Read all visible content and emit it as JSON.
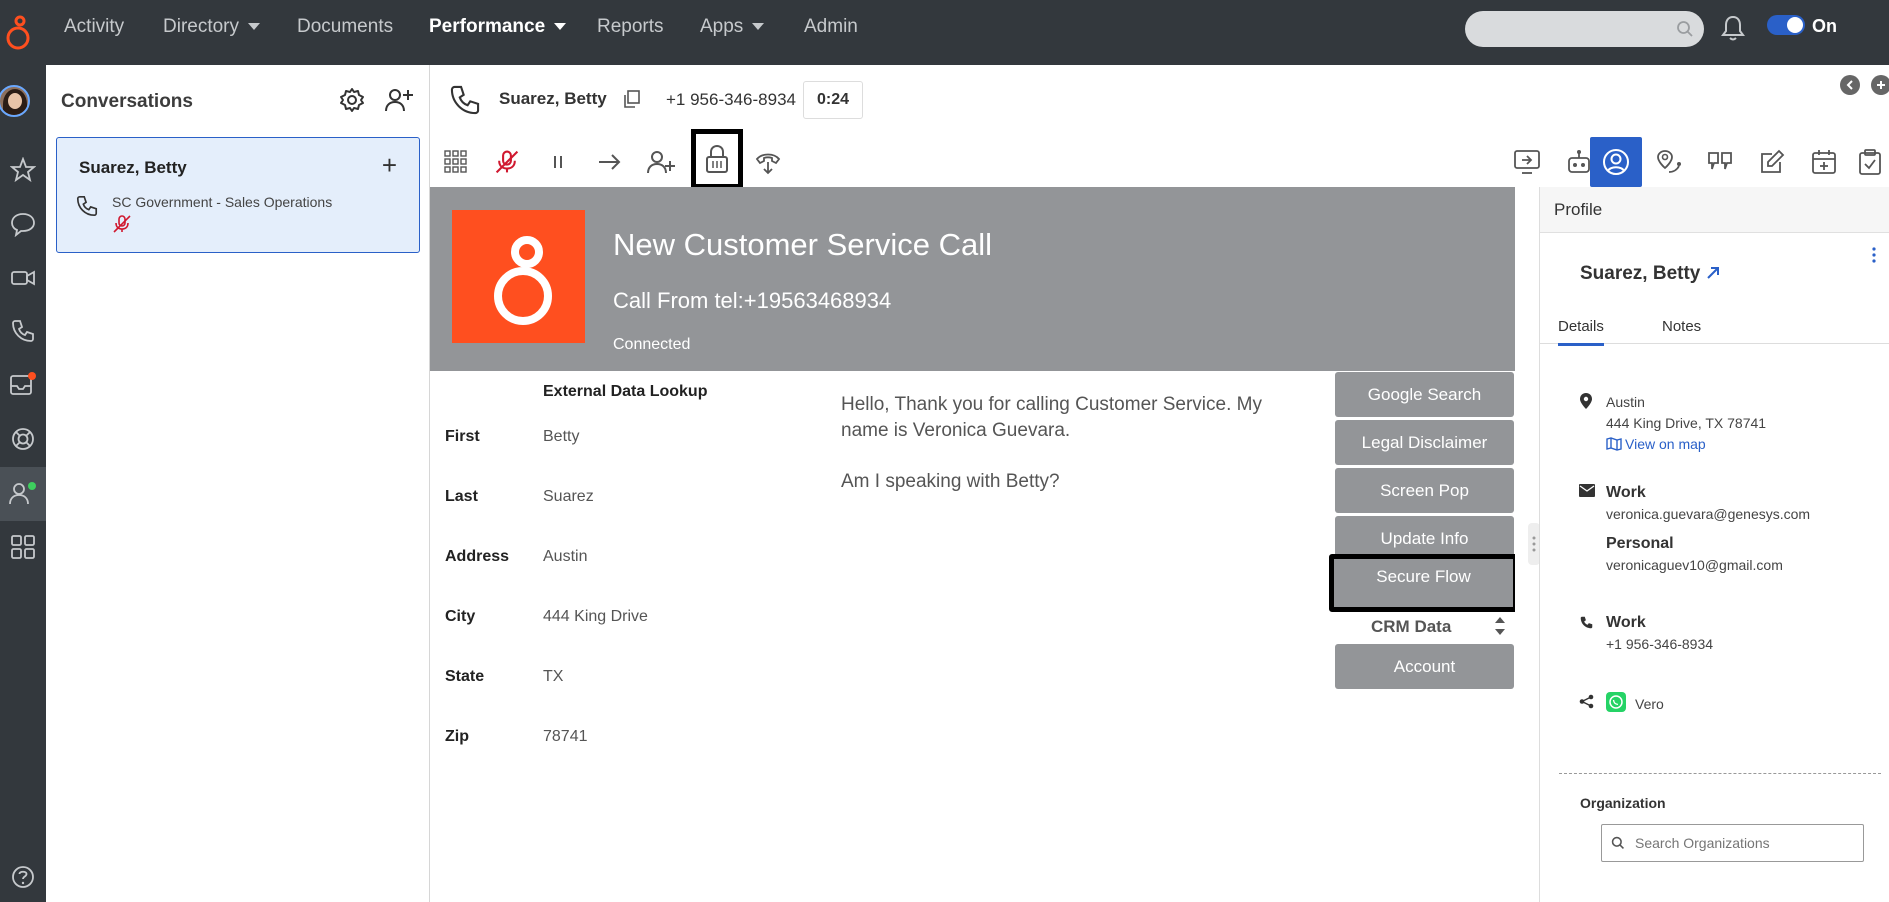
{
  "topnav": {
    "items": [
      {
        "label": "Activity",
        "caret": false,
        "active": false
      },
      {
        "label": "Directory",
        "caret": true,
        "active": false
      },
      {
        "label": "Documents",
        "caret": false,
        "active": false
      },
      {
        "label": "Performance",
        "caret": true,
        "active": true
      },
      {
        "label": "Reports",
        "caret": false,
        "active": false
      },
      {
        "label": "Apps",
        "caret": true,
        "active": false
      },
      {
        "label": "Admin",
        "caret": false,
        "active": false
      }
    ],
    "search_placeholder": "",
    "status_label": "On Queue"
  },
  "conversations": {
    "title": "Conversations",
    "card": {
      "name": "Suarez, Betty",
      "queue": "SC Government - Sales Operations"
    }
  },
  "call": {
    "name": "Suarez, Betty",
    "phone": "+1 956-346-8934",
    "timer": "0:24"
  },
  "script": {
    "banner": {
      "title": "New Customer Service Call",
      "from": "Call From tel:+19563468934",
      "status": "Connected"
    },
    "lookup_title": "External Data Lookup",
    "fields": [
      {
        "label": "First",
        "value": "Betty"
      },
      {
        "label": "Last",
        "value": "Suarez"
      },
      {
        "label": "Address",
        "value": "Austin"
      },
      {
        "label": "City",
        "value": "444 King Drive"
      },
      {
        "label": "State",
        "value": "TX"
      },
      {
        "label": "Zip",
        "value": "78741"
      }
    ],
    "greeting": [
      "Hello, Thank you for calling Customer Service. My name is Veronica Guevara.",
      "Am I speaking with Betty?"
    ],
    "buttons": {
      "google_search": "Google Search",
      "legal_disclaimer": "Legal Disclaimer",
      "screen_pop": "Screen Pop",
      "update_info": "Update Info",
      "secure_flow": "Secure Flow",
      "crm_label": "CRM Data",
      "account": "Account"
    }
  },
  "profile": {
    "header": "Profile",
    "name": "Suarez, Betty",
    "tabs": {
      "details": "Details",
      "notes": "Notes"
    },
    "address": {
      "city": "Austin",
      "line": "444 King Drive, TX 78741",
      "map_link": "View on map"
    },
    "email": {
      "work_label": "Work",
      "work": "veronica.guevara@genesys.com",
      "personal_label": "Personal",
      "personal": "veronicaguev10@gmail.com"
    },
    "phone": {
      "label": "Work",
      "value": "+1 956-346-8934"
    },
    "social": {
      "handle": "Vero"
    },
    "organization": {
      "label": "Organization",
      "placeholder": "Search Organizations"
    }
  },
  "colors": {
    "topbar": "#33383d",
    "accent": "#2a60c8",
    "brand_orange": "#ff4f1f",
    "banner_gray": "#939598",
    "mute_red": "#d0182f",
    "whatsapp_green": "#25d366"
  }
}
